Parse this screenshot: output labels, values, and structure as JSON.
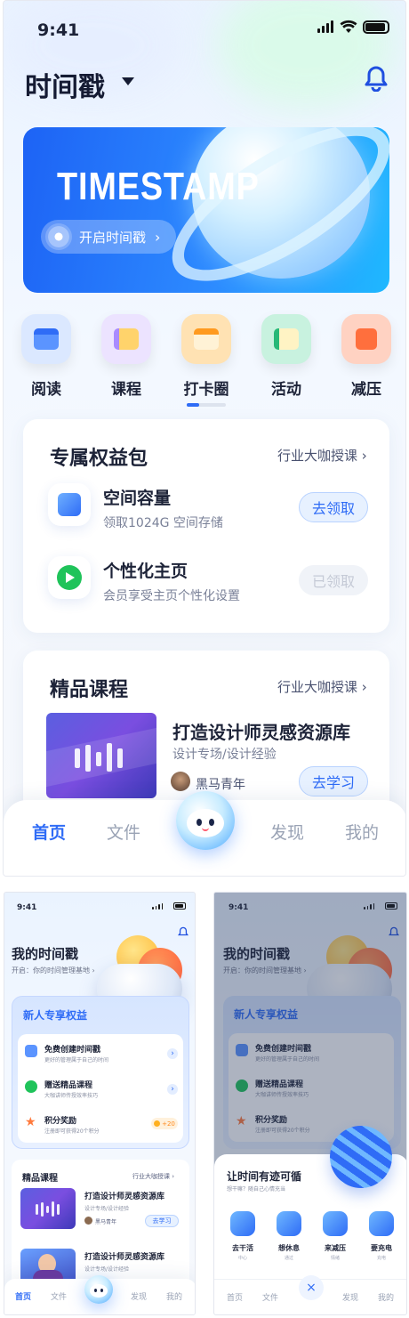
{
  "status": {
    "time": "9:41"
  },
  "main": {
    "title": "时间戳",
    "banner": {
      "brand": "TIMESTAMP",
      "button": "开启时间戳"
    },
    "categories": [
      {
        "label": "阅读",
        "icon": "read-icon",
        "color": "#6fa6ff"
      },
      {
        "label": "课程",
        "icon": "course-icon",
        "color": "#a98bff"
      },
      {
        "label": "打卡圈",
        "icon": "checkin-icon",
        "color": "#ffb23d"
      },
      {
        "label": "活动",
        "icon": "activity-icon",
        "color": "#36c98a"
      },
      {
        "label": "减压",
        "icon": "relax-icon",
        "color": "#ff6f3d"
      }
    ],
    "benefits": {
      "title": "专属权益包",
      "link": "行业大咖授课",
      "items": [
        {
          "title": "空间容量",
          "desc": "领取1024G 空间存储",
          "button": "去领取"
        },
        {
          "title": "个性化主页",
          "desc": "会员享受主页个性化设置",
          "button": "已领取"
        }
      ]
    },
    "courses": {
      "title": "精品课程",
      "link": "行业大咖授课",
      "item": {
        "title": "打造设计师灵感资源库",
        "desc": "设计专场/设计经验",
        "author": "黑马青年",
        "button": "去学习"
      }
    },
    "tabs": [
      "首页",
      "文件",
      "发现",
      "我的"
    ]
  },
  "mini1": {
    "time": "9:41",
    "title": "我的时间戳",
    "subtitle": "开启：你的时间管理基地",
    "panel_title": "新人专享权益",
    "items": [
      {
        "title": "免费创建时间戳",
        "desc": "更好的管理属于自己的时间"
      },
      {
        "title": "赠送精品课程",
        "desc": "大咖讲师传授效率技巧"
      },
      {
        "title": "积分奖励",
        "desc": "注册即可获得20个积分",
        "badge": "+20"
      }
    ],
    "courses_title": "精品课程",
    "courses_link": "行业大咖授课",
    "course1": {
      "title": "打造设计师灵感资源库",
      "desc": "设计专场/设计经验",
      "author": "黑马青年",
      "button": "去学习"
    },
    "course2": {
      "title": "打造设计师灵感资源库",
      "desc": "设计专场/设计经验"
    },
    "tabs": [
      "首页",
      "文件",
      "发现",
      "我的"
    ]
  },
  "mini2": {
    "time": "9:41",
    "title": "我的时间戳",
    "subtitle": "开启：你的时间管理基地",
    "panel_title": "新人专享权益",
    "items": [
      {
        "title": "免费创建时间戳",
        "desc": "更好的管理属于自己的时间"
      },
      {
        "title": "赠送精品课程",
        "desc": "大咖讲师传授效率技巧"
      },
      {
        "title": "积分奖励",
        "desc": "注册即可获得20个积分"
      }
    ],
    "sheet": {
      "title": "让时间有迹可循",
      "subtitle": "想干嘛？随自己心情充当",
      "actions": [
        {
          "label": "去干活",
          "sub": "中心"
        },
        {
          "label": "想休息",
          "sub": "通过"
        },
        {
          "label": "来减压",
          "sub": "情绪"
        },
        {
          "label": "要充电",
          "sub": "充电"
        }
      ]
    },
    "tabs": [
      "首页",
      "文件",
      "发现",
      "我的"
    ]
  }
}
